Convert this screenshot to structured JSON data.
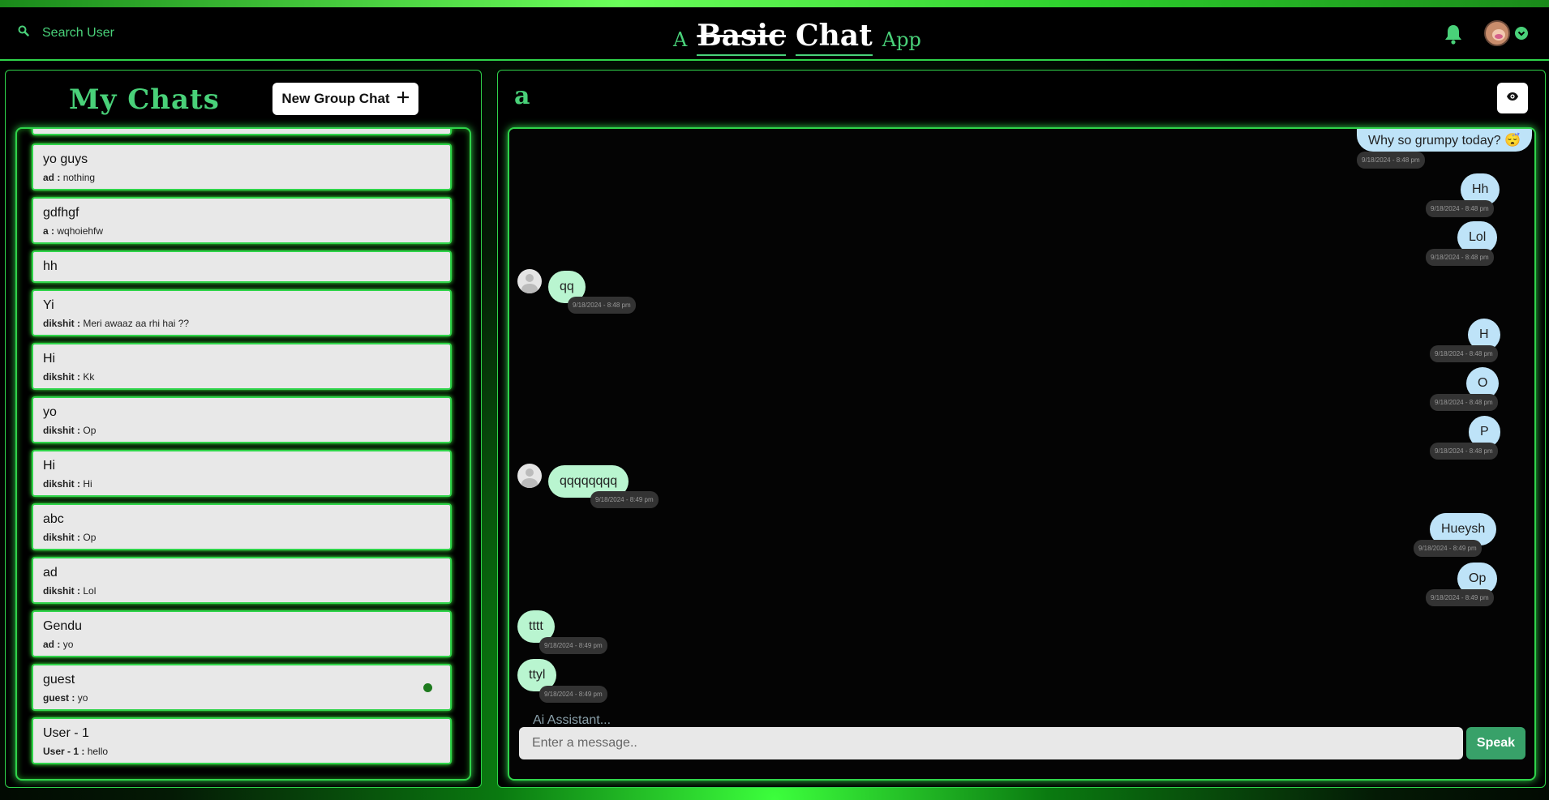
{
  "header": {
    "search_label": "Search User",
    "brand_a": "A",
    "brand_basic": "Basic",
    "brand_chat": "Chat",
    "brand_app": "App"
  },
  "left": {
    "title": "My Chats",
    "new_group_label": "New Group Chat",
    "chats": [
      {
        "name": "yo guys",
        "sender": "ad :",
        "message": "nothing"
      },
      {
        "name": "gdfhgf",
        "sender": "a :",
        "message": "wqhoiehfw"
      },
      {
        "name": "hh",
        "sender": "",
        "message": ""
      },
      {
        "name": "Yi",
        "sender": "dikshit :",
        "message": "Meri awaaz aa rhi hai ??"
      },
      {
        "name": "Hi",
        "sender": "dikshit :",
        "message": "Kk"
      },
      {
        "name": "yo",
        "sender": "dikshit :",
        "message": "Op"
      },
      {
        "name": "Hi",
        "sender": "dikshit :",
        "message": "Hi"
      },
      {
        "name": "abc",
        "sender": "dikshit :",
        "message": "Op"
      },
      {
        "name": "ad",
        "sender": "dikshit :",
        "message": "Lol"
      },
      {
        "name": "Gendu",
        "sender": "ad :",
        "message": "yo"
      },
      {
        "name": "guest",
        "sender": "guest :",
        "message": "yo"
      },
      {
        "name": "User - 1",
        "sender": "User - 1 :",
        "message": "hello"
      }
    ]
  },
  "right": {
    "chat_title": "a",
    "messages": [
      {
        "text": "Why so grumpy today? 😴",
        "time": "9/18/2024 - 8:48 pm",
        "mine": true
      },
      {
        "text": "Hh",
        "time": "9/18/2024 - 8:48 pm",
        "mine": true
      },
      {
        "text": "Lol",
        "time": "9/18/2024 - 8:48 pm",
        "mine": true
      },
      {
        "text": "qq",
        "time": "9/18/2024 - 8:48 pm",
        "mine": false
      },
      {
        "text": "H",
        "time": "9/18/2024 - 8:48 pm",
        "mine": true
      },
      {
        "text": "O",
        "time": "9/18/2024 - 8:48 pm",
        "mine": true
      },
      {
        "text": "P",
        "time": "9/18/2024 - 8:48 pm",
        "mine": true
      },
      {
        "text": "qqqqqqqq",
        "time": "9/18/2024 - 8:49 pm",
        "mine": false
      },
      {
        "text": "Hueysh",
        "time": "9/18/2024 - 8:49 pm",
        "mine": true
      },
      {
        "text": "Op",
        "time": "9/18/2024 - 8:49 pm",
        "mine": true
      },
      {
        "text": "tttt",
        "time": "9/18/2024 - 8:49 pm",
        "mine": false
      },
      {
        "text": "ttyl",
        "time": "9/18/2024 - 8:49 pm",
        "mine": false
      }
    ],
    "ai_label": "Ai Assistant...",
    "input_placeholder": "Enter a message..",
    "speak_label": "Speak"
  }
}
